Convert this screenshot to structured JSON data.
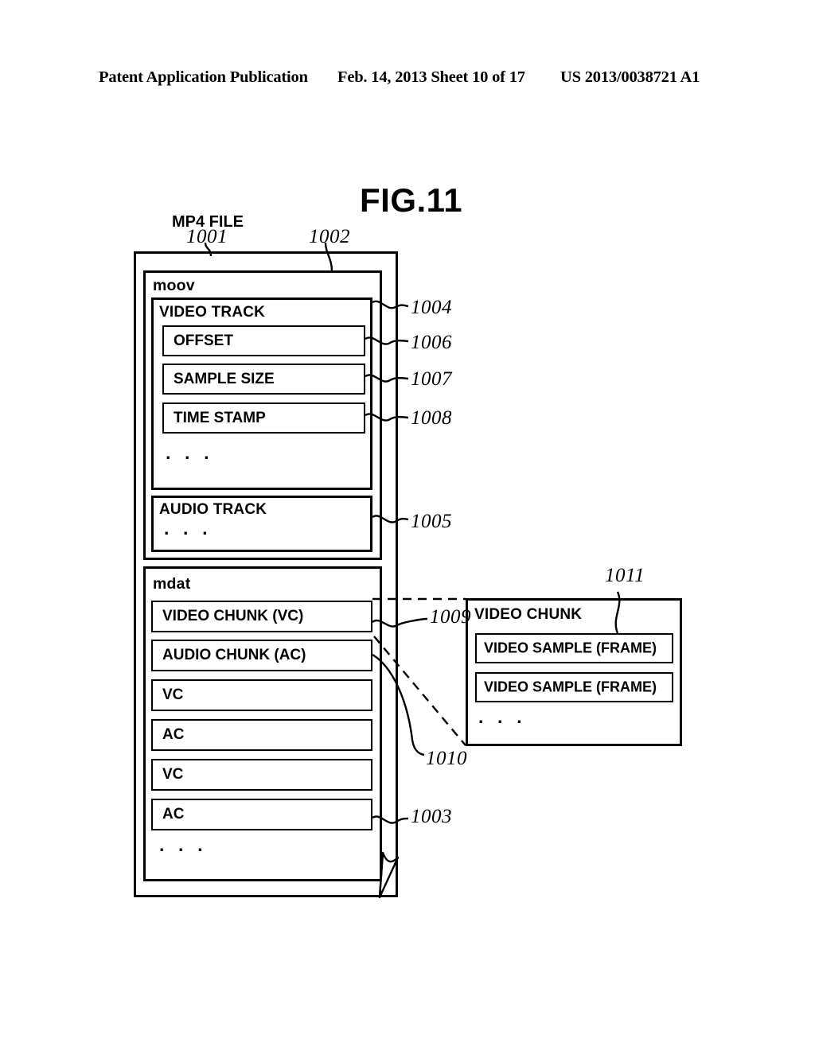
{
  "header": {
    "publication": "Patent Application Publication",
    "date": "Feb. 14, 2013",
    "sheet": "Sheet 10 of 17",
    "patent_number": "US 2013/0038721 A1",
    "date_sheet": "Feb. 14, 2013  Sheet 10 of 17"
  },
  "figure": {
    "title": "FIG.11",
    "mp4_file_label": "MP4 FILE"
  },
  "diagram": {
    "mp4_file": {
      "ref": "1001",
      "page_curl_ref": "1003"
    },
    "moov": {
      "label": "moov",
      "ref": "1002",
      "video_track": {
        "label": "VIDEO TRACK",
        "ref": "1004",
        "fields": [
          {
            "label": "OFFSET",
            "ref": "1006"
          },
          {
            "label": "SAMPLE SIZE",
            "ref": "1007"
          },
          {
            "label": "TIME STAMP",
            "ref": "1008"
          }
        ],
        "ellipsis": "· · ·"
      },
      "audio_track": {
        "label": "AUDIO TRACK",
        "ref": "1005",
        "ellipsis": "· · ·"
      }
    },
    "mdat": {
      "label": "mdat",
      "ref": "1003",
      "chunks": [
        {
          "label": "VIDEO CHUNK (VC)",
          "ref": "1009"
        },
        {
          "label": "AUDIO CHUNK (AC)",
          "ref": ""
        },
        {
          "label": "VC",
          "ref": ""
        },
        {
          "label": "AC",
          "ref": ""
        },
        {
          "label": "VC",
          "ref": ""
        },
        {
          "label": "AC",
          "ref": ""
        }
      ],
      "ellipsis": "· · ·",
      "expansion_ref": "1010"
    },
    "video_chunk_detail": {
      "label": "VIDEO CHUNK",
      "ref": "1011",
      "samples": [
        {
          "label": "VIDEO SAMPLE (FRAME)"
        },
        {
          "label": "VIDEO SAMPLE (FRAME)"
        }
      ],
      "ellipsis": "· · ·"
    },
    "reference_numerals": {
      "n1001": "1001",
      "n1002": "1002",
      "n1003": "1003",
      "n1004": "1004",
      "n1005": "1005",
      "n1006": "1006",
      "n1007": "1007",
      "n1008": "1008",
      "n1009": "1009",
      "n1010": "1010",
      "n1011": "1011"
    }
  },
  "colors": {
    "ink": "#000000",
    "paper": "#ffffff"
  }
}
